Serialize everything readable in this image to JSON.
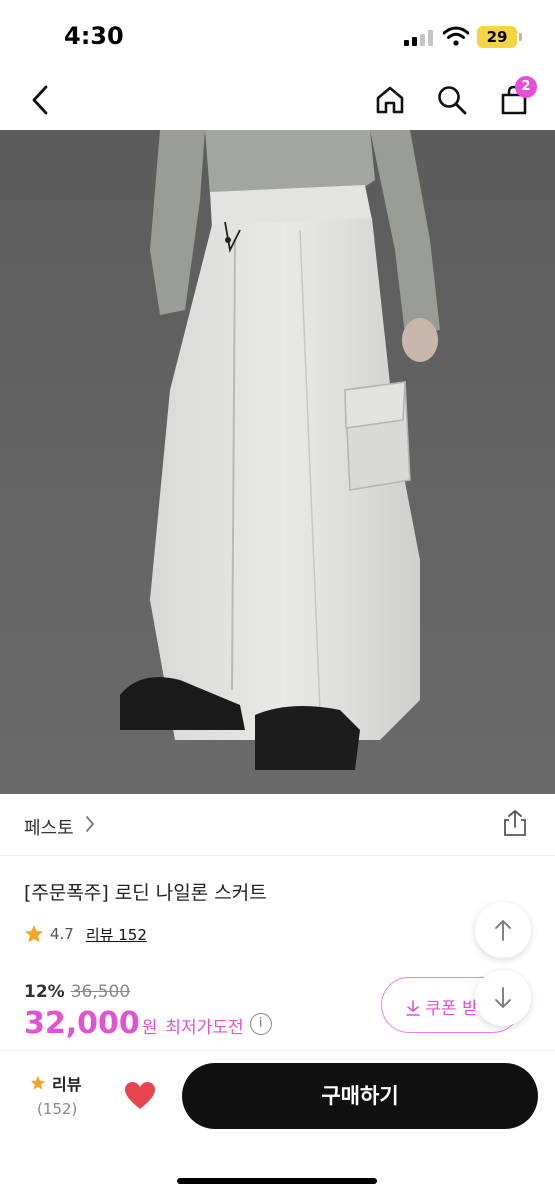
{
  "status_bar": {
    "time": "4:30",
    "battery": "29"
  },
  "nav": {
    "cart_badge": "2"
  },
  "product_image": {
    "description_icon": "product-photo"
  },
  "brand": {
    "name": "페스토"
  },
  "product": {
    "title": "[주문폭주] 로딘 나일론 스커트",
    "rating": "4.7",
    "review_link": "리뷰 152"
  },
  "pricing": {
    "discount": "12%",
    "original_price": "36,500",
    "price": "32,000",
    "price_unit": "원",
    "lowest_label": "최저가도전",
    "info_glyph": "i"
  },
  "coupon": {
    "label": "쿠폰 받"
  },
  "bottom_bar": {
    "review_label": "리뷰",
    "review_count": "(152)",
    "buy_label": "구매하기"
  },
  "colors": {
    "accent": "#e250d3",
    "star": "#f4a52b",
    "heart": "#e8444f",
    "buy_button": "#111111"
  }
}
